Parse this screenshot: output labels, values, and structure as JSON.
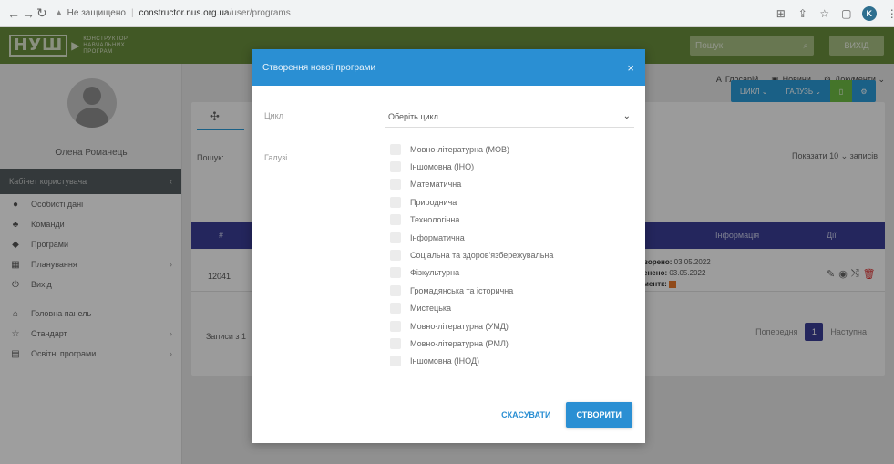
{
  "browser": {
    "security_label": "Не защищено",
    "host": "constructor.nus.org.ua",
    "path": "/user/programs",
    "profile_initial": "K"
  },
  "header": {
    "logo_main": "НУШ",
    "logo_sub": [
      "КОНСТРУКТОР",
      "НАВЧАЛЬНИХ",
      "ПРОГРАМ"
    ],
    "search_placeholder": "Пошук",
    "exit_label": "ВИХІД"
  },
  "sidebar": {
    "user_name": "Олена Романець",
    "cabinet_label": "Кабінет користувача",
    "items": [
      {
        "label": "Особисті дані",
        "icon": "user-icon"
      },
      {
        "label": "Команди",
        "icon": "team-icon"
      },
      {
        "label": "Програми",
        "icon": "programs-icon"
      },
      {
        "label": "Планування",
        "icon": "planning-icon"
      },
      {
        "label": "Вихід",
        "icon": "power-icon"
      }
    ],
    "items2": [
      {
        "label": "Головна панель",
        "icon": "home-icon"
      },
      {
        "label": "Стандарт",
        "icon": "star-icon"
      },
      {
        "label": "Освітні програми",
        "icon": "document-icon"
      }
    ]
  },
  "top_links": {
    "glossary": "Глосарій",
    "news": "Новини",
    "documents": "Документи"
  },
  "toolbar": {
    "cycle_label": "ЦИКЛ",
    "branch_label": "ГАЛУЗЬ"
  },
  "table": {
    "search_label": "Пошук:",
    "show_label": "Показати",
    "show_value": "10",
    "entries_label": "записів",
    "col_hash": "#",
    "col_info": "Інформація",
    "col_actions": "Дії",
    "row": {
      "id": "12041",
      "created_label": "ворено:",
      "created_value": "03.05.2022",
      "updated_label": "енено:",
      "updated_value": "03.05.2022",
      "comments_label": "ментк:"
    },
    "footer": "Записи з 1",
    "prev": "Попередня",
    "page": "1",
    "next": "Наступна"
  },
  "modal": {
    "title": "Створення нової програми",
    "cycle_label": "Цикл",
    "cycle_value": "Оберіть цикл",
    "branches_label": "Галузі",
    "branches": [
      "Мовно-літературна (МОВ)",
      "Іншомовна (ІНО)",
      "Математична",
      "Природнича",
      "Технологічна",
      "Інформатична",
      "Соціальна та здоров'язбережувальна",
      "Фізкультурна",
      "Громадянська та історична",
      "Мистецька",
      "Мовно-літературна (УМД)",
      "Мовно-літературна (РМЛ)",
      "Іншомовна (ІНОД)"
    ],
    "cancel_label": "СКАСУВАТИ",
    "create_label": "СТВОРИТИ"
  }
}
